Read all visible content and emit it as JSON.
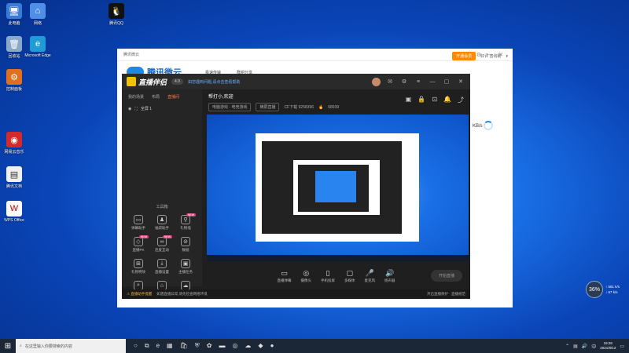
{
  "desktop": {
    "icons": [
      {
        "label": "此电脑",
        "glyph": "🖥"
      },
      {
        "label": "腾讯QQ",
        "glyph": "🐧"
      },
      {
        "label": "网络",
        "glyph": "⌂"
      },
      {
        "label": "回收站",
        "glyph": "🗑"
      },
      {
        "label": "Microsoft Edge",
        "glyph": "e"
      },
      {
        "label": "控制面板",
        "glyph": "⚙"
      },
      {
        "label": "网易云音乐",
        "glyph": "◉"
      },
      {
        "label": "腾讯文档",
        "glyph": "▤"
      },
      {
        "label": "WPS Office",
        "glyph": "W"
      }
    ]
  },
  "tencent_window": {
    "title": "腾讯微云",
    "logo_text": "腾讯微云",
    "tabs": [
      "极速传输",
      "群组分享"
    ],
    "right_items": {
      "button": "开通会员",
      "user": "好评 咨询助",
      "menu": "▾"
    },
    "speed": "KB/s"
  },
  "app": {
    "name": "直播伴侣",
    "version": "4.9",
    "notice": "如您遇到问题,请点击查看帮助",
    "side_tabs": [
      "我的场景",
      "布局",
      "直播间"
    ],
    "scene": "全屏 1",
    "tools_title": "工具箱",
    "tools": [
      {
        "label": "弹幕助手",
        "glyph": "▭",
        "badge": ""
      },
      {
        "label": "福袋助手",
        "glyph": "♟",
        "badge": ""
      },
      {
        "label": "礼物墙",
        "glyph": "⚲",
        "badge": "NEW"
      },
      {
        "label": "直播PK",
        "glyph": "◇",
        "badge": "NEW"
      },
      {
        "label": "连麦互动",
        "glyph": "∞",
        "badge": "NEW"
      },
      {
        "label": "数据",
        "glyph": "⊘",
        "badge": ""
      },
      {
        "label": "礼物特效",
        "glyph": "⊞",
        "badge": ""
      },
      {
        "label": "直播设置",
        "glyph": "⤓",
        "badge": ""
      },
      {
        "label": "主播任务",
        "glyph": "▣",
        "badge": ""
      },
      {
        "label": "搜索",
        "glyph": "⌕",
        "badge": ""
      },
      {
        "label": "门店",
        "glyph": "⌂",
        "badge": ""
      },
      {
        "label": "更多",
        "glyph": "☁",
        "badge": ""
      }
    ],
    "stream_title": "帮打小,欢迎",
    "stream_meta": [
      "电脑游戏 - 电竞游戏",
      "横屏直播"
    ],
    "stream_stats": "CF下载 9258396",
    "stream_hot": "68939",
    "controls": [
      {
        "label": "直播弹幕",
        "glyph": "▭"
      },
      {
        "label": "摄像头",
        "glyph": "◎"
      },
      {
        "label": "手机投屏",
        "glyph": "▯"
      },
      {
        "label": "多媒体",
        "glyph": "▢"
      },
      {
        "label": "麦克风",
        "glyph": "🎤"
      },
      {
        "label": "扬声器",
        "glyph": "🔊"
      }
    ],
    "go_live": "开始直播",
    "footer_warn": "⚠ 直播助手提醒",
    "footer_notice": "如遇直播异常,请先检查网络环境",
    "footer_right": "开启直播保护 · 直播规范"
  },
  "net_widget": {
    "percent": "36%",
    "up": "↑ 581 k/s",
    "down": "↓ 67 k/s"
  },
  "taskbar": {
    "search_placeholder": "在这里输入你要搜索的内容",
    "time": "19:26",
    "date": "2021/8/12",
    "lang": "中"
  }
}
